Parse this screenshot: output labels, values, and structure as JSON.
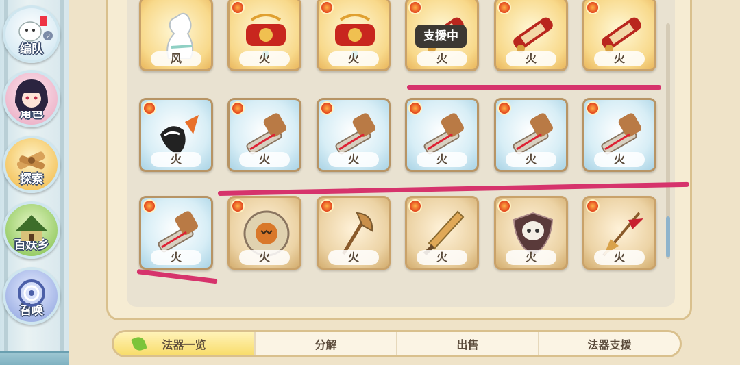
{
  "nav": [
    {
      "label": "编队",
      "icon": "formation-icon",
      "badge": "2"
    },
    {
      "label": "角色",
      "icon": "character-icon"
    },
    {
      "label": "探索",
      "icon": "explore-icon"
    },
    {
      "label": "百妖乡",
      "icon": "village-icon"
    },
    {
      "label": "召唤",
      "icon": "summon-icon"
    }
  ],
  "tooltip": "支援中",
  "rows": [
    [
      {
        "elem": "风",
        "icon": "cloth-bag-icon",
        "style": "gold"
      },
      {
        "elem": "火",
        "icon": "red-dragon-scroll-icon",
        "style": "gold"
      },
      {
        "elem": "火",
        "icon": "red-dragon-scroll-icon",
        "style": "gold"
      },
      {
        "elem": "火",
        "icon": "red-scroll-icon",
        "style": "gold"
      },
      {
        "elem": "火",
        "icon": "red-scroll-icon",
        "style": "gold"
      },
      {
        "elem": "火",
        "icon": "red-scroll-icon",
        "style": "gold"
      }
    ],
    [
      {
        "elem": "火",
        "icon": "mask-fan-icon",
        "style": "blue"
      },
      {
        "elem": "火",
        "icon": "gauntlet-blade-icon",
        "style": "blue"
      },
      {
        "elem": "火",
        "icon": "gauntlet-blade-icon",
        "style": "blue"
      },
      {
        "elem": "火",
        "icon": "gauntlet-blade-icon",
        "style": "blue"
      },
      {
        "elem": "火",
        "icon": "gauntlet-blade-icon",
        "style": "blue"
      },
      {
        "elem": "火",
        "icon": "gauntlet-blade-icon",
        "style": "blue"
      }
    ],
    [
      {
        "elem": "火",
        "icon": "gauntlet-blade-icon",
        "style": "blue"
      },
      {
        "elem": "火",
        "icon": "pumpkin-wheel-icon",
        "style": "tan"
      },
      {
        "elem": "火",
        "icon": "axe-icon",
        "style": "tan"
      },
      {
        "elem": "火",
        "icon": "sword-icon",
        "style": "tan"
      },
      {
        "elem": "火",
        "icon": "skull-shield-icon",
        "style": "tan"
      },
      {
        "elem": "火",
        "icon": "spear-icon",
        "style": "tan"
      }
    ]
  ],
  "tabs": [
    {
      "label": "法器一览",
      "active": true
    },
    {
      "label": "分解",
      "active": false
    },
    {
      "label": "出售",
      "active": false
    },
    {
      "label": "法器支援",
      "active": false
    }
  ]
}
